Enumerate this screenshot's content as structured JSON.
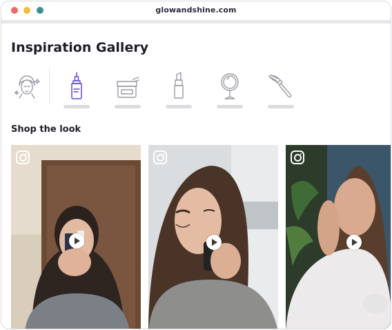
{
  "browser": {
    "url": "glowandshine.com",
    "colors": {
      "close": "#ef6b6b",
      "minimize": "#f2bd3e",
      "zoom": "#3d8f8e"
    }
  },
  "page": {
    "title": "Inspiration Gallery",
    "section_title": "Shop the look"
  },
  "categories": [
    {
      "icon": "face-care-icon",
      "active": false
    },
    {
      "icon": "serum-dropper-icon",
      "active": true
    },
    {
      "icon": "cream-jar-icon",
      "active": false
    },
    {
      "icon": "lipstick-icon",
      "active": false
    },
    {
      "icon": "mirror-icon",
      "active": false
    },
    {
      "icon": "makeup-brush-icon",
      "active": false
    }
  ],
  "gallery": [
    {
      "icon": "instagram-icon",
      "action": "play-icon"
    },
    {
      "icon": "instagram-icon",
      "action": "play-icon"
    },
    {
      "icon": "instagram-icon",
      "action": "play-icon"
    }
  ],
  "theme": {
    "accent": "#5b4bd8",
    "icon_gray": "#9a9aa4",
    "bar_gray": "#dcdce0"
  }
}
